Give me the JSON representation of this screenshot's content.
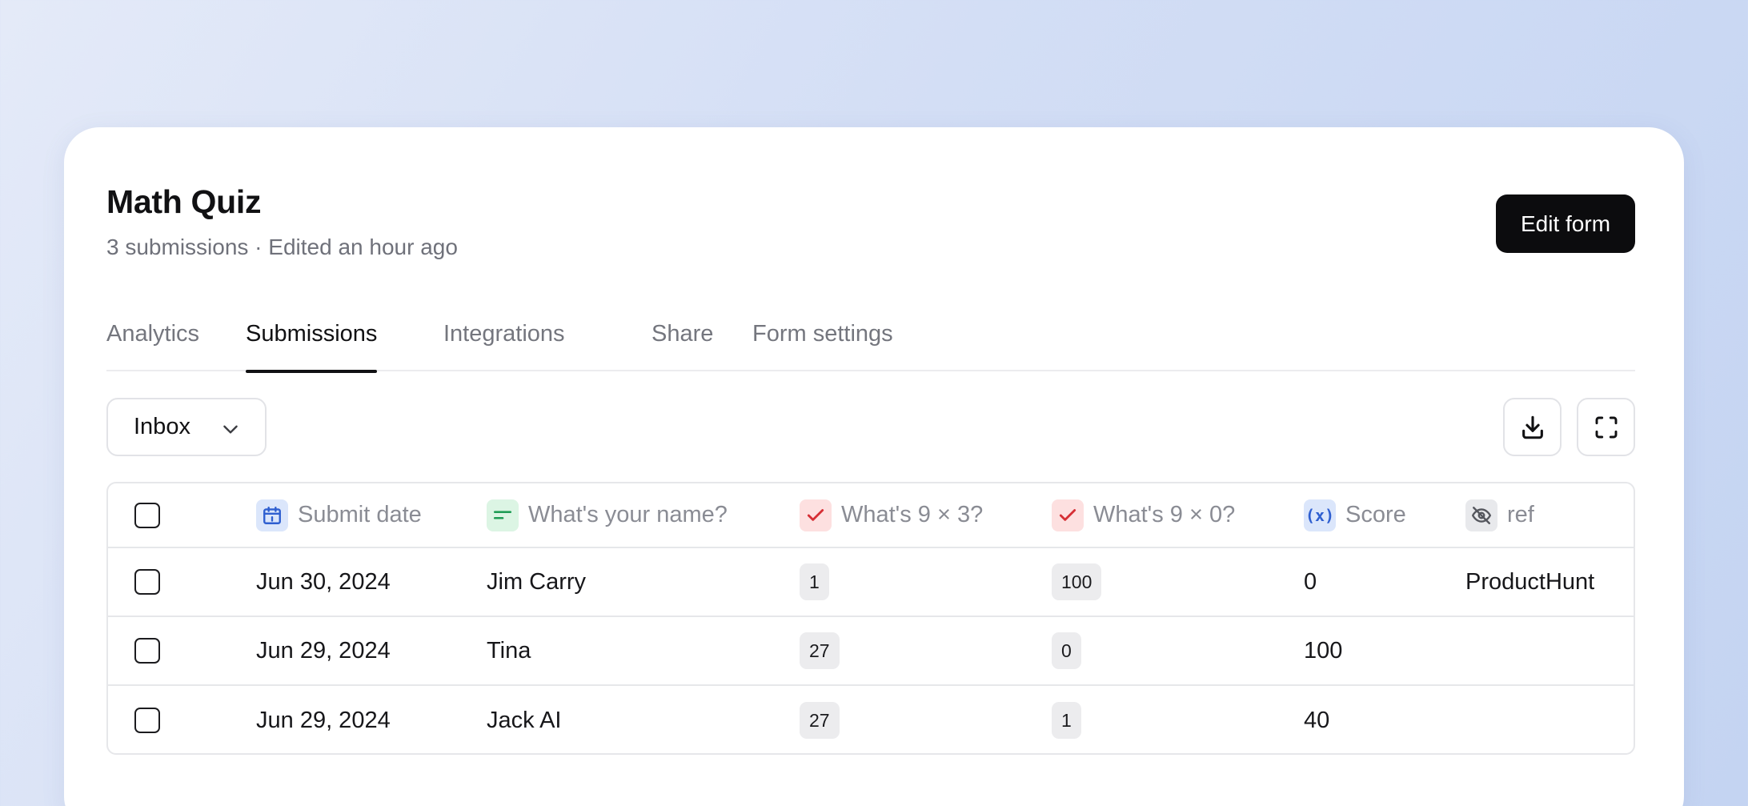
{
  "form": {
    "title": "Math Quiz",
    "subtitle": "3 submissions · Edited an hour ago",
    "edit_button": "Edit form"
  },
  "tabs": [
    {
      "label": "Analytics",
      "active": false
    },
    {
      "label": "Submissions",
      "active": true
    },
    {
      "label": "Integrations",
      "active": false
    },
    {
      "label": "Share",
      "active": false
    },
    {
      "label": "Form settings",
      "active": false
    }
  ],
  "toolbar": {
    "view_select": "Inbox",
    "download_icon": "download-icon",
    "expand_icon": "fullscreen-icon"
  },
  "table": {
    "columns": [
      {
        "label": "Submit date",
        "icon": "calendar-icon",
        "icon_color": "#2f5fd0",
        "icon_bg": "#dbe6fb"
      },
      {
        "label": "What's your name?",
        "icon": "short-text-icon",
        "icon_color": "#1f9d55",
        "icon_bg": "#dcf5e4"
      },
      {
        "label": "What's 9 × 3?",
        "icon": "check-icon",
        "icon_color": "#d62f35",
        "icon_bg": "#fde0e0"
      },
      {
        "label": "What's 9 × 0?",
        "icon": "check-icon",
        "icon_color": "#d62f35",
        "icon_bg": "#fde0e0"
      },
      {
        "label": "Score",
        "icon": "variable-icon",
        "icon_color": "#2f5fd0",
        "icon_bg": "#dbe6fb"
      },
      {
        "label": "ref",
        "icon": "eye-off-icon",
        "icon_color": "#55575e",
        "icon_bg": "#e8e9ec"
      }
    ],
    "rows": [
      {
        "date": "Jun 30, 2024",
        "name": "Jim Carry",
        "q1": "1",
        "q2": "100",
        "score": "0",
        "ref": "ProductHunt"
      },
      {
        "date": "Jun 29, 2024",
        "name": "Tina",
        "q1": "27",
        "q2": "0",
        "score": "100",
        "ref": ""
      },
      {
        "date": "Jun 29, 2024",
        "name": "Jack AI",
        "q1": "27",
        "q2": "1",
        "score": "40",
        "ref": ""
      }
    ]
  }
}
